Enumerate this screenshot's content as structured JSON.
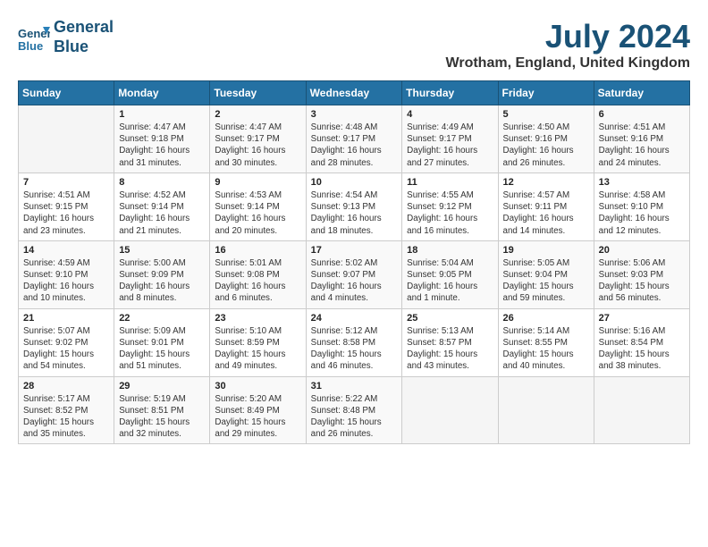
{
  "header": {
    "logo_line1": "General",
    "logo_line2": "Blue",
    "month_year": "July 2024",
    "location": "Wrotham, England, United Kingdom"
  },
  "weekdays": [
    "Sunday",
    "Monday",
    "Tuesday",
    "Wednesday",
    "Thursday",
    "Friday",
    "Saturday"
  ],
  "weeks": [
    [
      {
        "day": "",
        "info": ""
      },
      {
        "day": "1",
        "info": "Sunrise: 4:47 AM\nSunset: 9:18 PM\nDaylight: 16 hours\nand 31 minutes."
      },
      {
        "day": "2",
        "info": "Sunrise: 4:47 AM\nSunset: 9:17 PM\nDaylight: 16 hours\nand 30 minutes."
      },
      {
        "day": "3",
        "info": "Sunrise: 4:48 AM\nSunset: 9:17 PM\nDaylight: 16 hours\nand 28 minutes."
      },
      {
        "day": "4",
        "info": "Sunrise: 4:49 AM\nSunset: 9:17 PM\nDaylight: 16 hours\nand 27 minutes."
      },
      {
        "day": "5",
        "info": "Sunrise: 4:50 AM\nSunset: 9:16 PM\nDaylight: 16 hours\nand 26 minutes."
      },
      {
        "day": "6",
        "info": "Sunrise: 4:51 AM\nSunset: 9:16 PM\nDaylight: 16 hours\nand 24 minutes."
      }
    ],
    [
      {
        "day": "7",
        "info": "Sunrise: 4:51 AM\nSunset: 9:15 PM\nDaylight: 16 hours\nand 23 minutes."
      },
      {
        "day": "8",
        "info": "Sunrise: 4:52 AM\nSunset: 9:14 PM\nDaylight: 16 hours\nand 21 minutes."
      },
      {
        "day": "9",
        "info": "Sunrise: 4:53 AM\nSunset: 9:14 PM\nDaylight: 16 hours\nand 20 minutes."
      },
      {
        "day": "10",
        "info": "Sunrise: 4:54 AM\nSunset: 9:13 PM\nDaylight: 16 hours\nand 18 minutes."
      },
      {
        "day": "11",
        "info": "Sunrise: 4:55 AM\nSunset: 9:12 PM\nDaylight: 16 hours\nand 16 minutes."
      },
      {
        "day": "12",
        "info": "Sunrise: 4:57 AM\nSunset: 9:11 PM\nDaylight: 16 hours\nand 14 minutes."
      },
      {
        "day": "13",
        "info": "Sunrise: 4:58 AM\nSunset: 9:10 PM\nDaylight: 16 hours\nand 12 minutes."
      }
    ],
    [
      {
        "day": "14",
        "info": "Sunrise: 4:59 AM\nSunset: 9:10 PM\nDaylight: 16 hours\nand 10 minutes."
      },
      {
        "day": "15",
        "info": "Sunrise: 5:00 AM\nSunset: 9:09 PM\nDaylight: 16 hours\nand 8 minutes."
      },
      {
        "day": "16",
        "info": "Sunrise: 5:01 AM\nSunset: 9:08 PM\nDaylight: 16 hours\nand 6 minutes."
      },
      {
        "day": "17",
        "info": "Sunrise: 5:02 AM\nSunset: 9:07 PM\nDaylight: 16 hours\nand 4 minutes."
      },
      {
        "day": "18",
        "info": "Sunrise: 5:04 AM\nSunset: 9:05 PM\nDaylight: 16 hours\nand 1 minute."
      },
      {
        "day": "19",
        "info": "Sunrise: 5:05 AM\nSunset: 9:04 PM\nDaylight: 15 hours\nand 59 minutes."
      },
      {
        "day": "20",
        "info": "Sunrise: 5:06 AM\nSunset: 9:03 PM\nDaylight: 15 hours\nand 56 minutes."
      }
    ],
    [
      {
        "day": "21",
        "info": "Sunrise: 5:07 AM\nSunset: 9:02 PM\nDaylight: 15 hours\nand 54 minutes."
      },
      {
        "day": "22",
        "info": "Sunrise: 5:09 AM\nSunset: 9:01 PM\nDaylight: 15 hours\nand 51 minutes."
      },
      {
        "day": "23",
        "info": "Sunrise: 5:10 AM\nSunset: 8:59 PM\nDaylight: 15 hours\nand 49 minutes."
      },
      {
        "day": "24",
        "info": "Sunrise: 5:12 AM\nSunset: 8:58 PM\nDaylight: 15 hours\nand 46 minutes."
      },
      {
        "day": "25",
        "info": "Sunrise: 5:13 AM\nSunset: 8:57 PM\nDaylight: 15 hours\nand 43 minutes."
      },
      {
        "day": "26",
        "info": "Sunrise: 5:14 AM\nSunset: 8:55 PM\nDaylight: 15 hours\nand 40 minutes."
      },
      {
        "day": "27",
        "info": "Sunrise: 5:16 AM\nSunset: 8:54 PM\nDaylight: 15 hours\nand 38 minutes."
      }
    ],
    [
      {
        "day": "28",
        "info": "Sunrise: 5:17 AM\nSunset: 8:52 PM\nDaylight: 15 hours\nand 35 minutes."
      },
      {
        "day": "29",
        "info": "Sunrise: 5:19 AM\nSunset: 8:51 PM\nDaylight: 15 hours\nand 32 minutes."
      },
      {
        "day": "30",
        "info": "Sunrise: 5:20 AM\nSunset: 8:49 PM\nDaylight: 15 hours\nand 29 minutes."
      },
      {
        "day": "31",
        "info": "Sunrise: 5:22 AM\nSunset: 8:48 PM\nDaylight: 15 hours\nand 26 minutes."
      },
      {
        "day": "",
        "info": ""
      },
      {
        "day": "",
        "info": ""
      },
      {
        "day": "",
        "info": ""
      }
    ]
  ]
}
